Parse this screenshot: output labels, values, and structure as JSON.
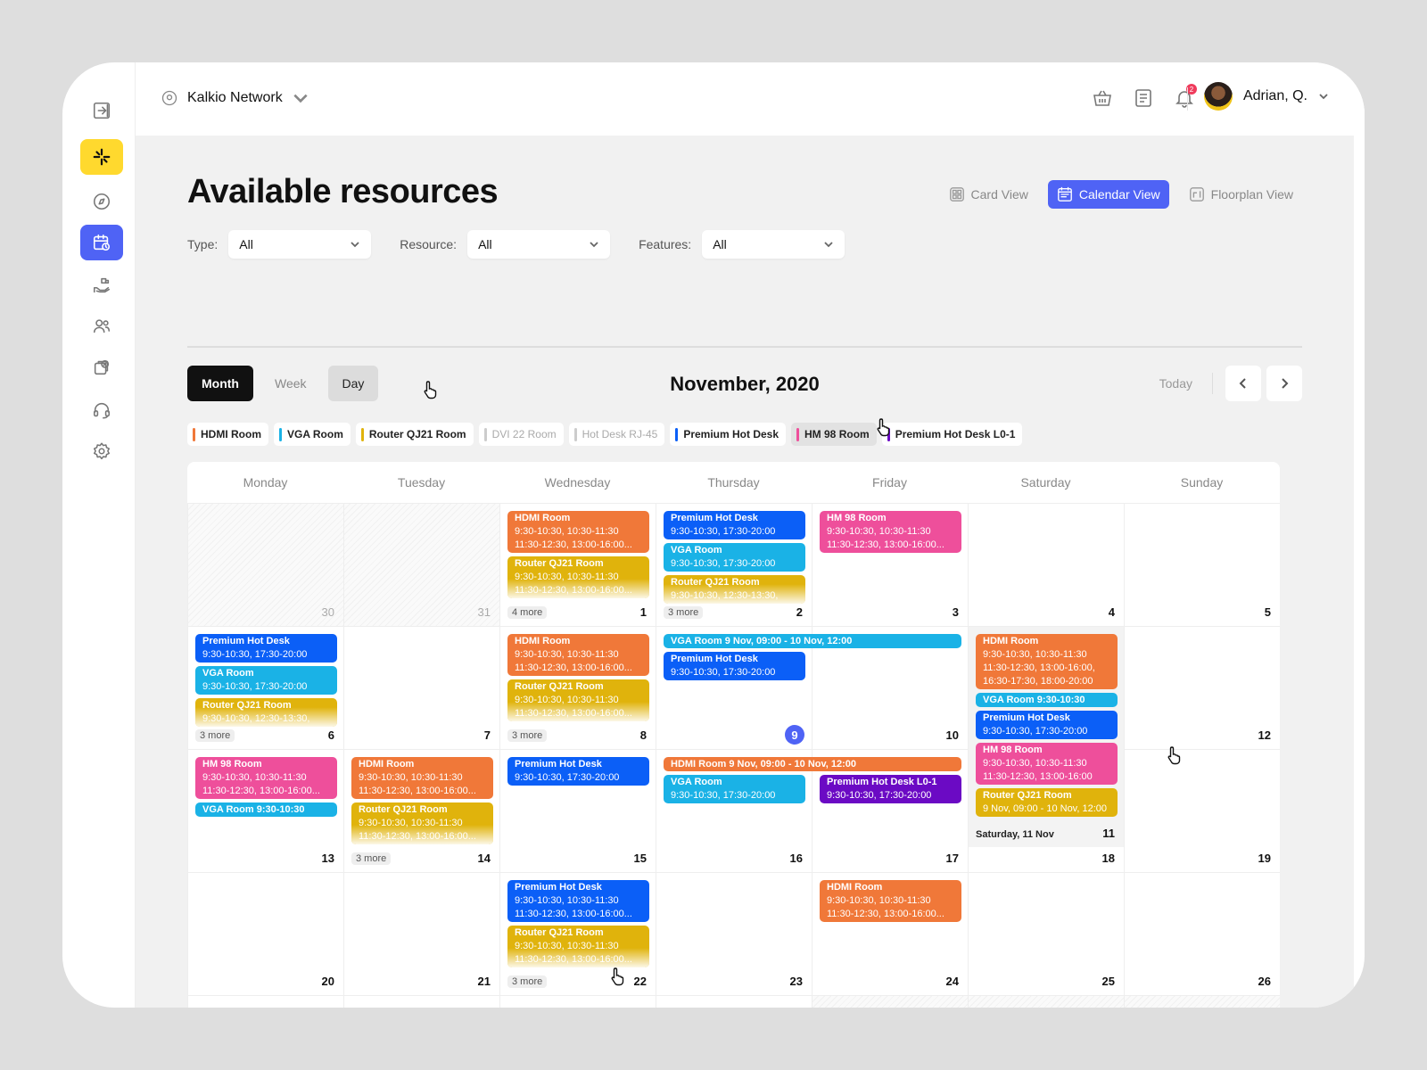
{
  "colors": {
    "accent": "#4f63f5",
    "hdmi": "#f07839",
    "vga": "#1ab2e6",
    "router": "#e0b30c",
    "premium": "#0b5ff7",
    "hm98": "#ee4f9b",
    "premiumL0": "#6b0ac4",
    "dvi": "#cccccc",
    "hotdesk": "#cccccc"
  },
  "network": {
    "name": "Kalkio Network"
  },
  "user": {
    "name": "Adrian, Q.",
    "notifications": "2"
  },
  "page": {
    "title": "Available resources"
  },
  "views": [
    {
      "label": "Card View",
      "icon": "grid-icon"
    },
    {
      "label": "Calendar View",
      "icon": "calendar-icon"
    },
    {
      "label": "Floorplan View",
      "icon": "floorplan-icon"
    }
  ],
  "filters": [
    {
      "label": "Type:",
      "value": "All"
    },
    {
      "label": "Resource:",
      "value": "All"
    },
    {
      "label": "Features:",
      "value": "All"
    }
  ],
  "modes": [
    "Month",
    "Week",
    "Day"
  ],
  "calendar": {
    "month_title": "November, 2020",
    "today_label": "Today"
  },
  "legend": [
    {
      "label": "HDMI Room",
      "color": "hdmi"
    },
    {
      "label": "VGA Room",
      "color": "vga"
    },
    {
      "label": "Router QJ21 Room",
      "color": "router"
    },
    {
      "label": "DVI 22 Room",
      "color": "dvi",
      "dim": true
    },
    {
      "label": "Hot Desk RJ-45",
      "color": "hotdesk",
      "dim": true
    },
    {
      "label": "Premium Hot Desk",
      "color": "premium"
    },
    {
      "label": "HM 98 Room",
      "color": "hm98",
      "hover": true
    },
    {
      "label": "Premium Hot Desk L0-1",
      "color": "premiumL0"
    }
  ],
  "weekdays": [
    "Monday",
    "Tuesday",
    "Wednesday",
    "Thursday",
    "Friday",
    "Saturday",
    "Sunday"
  ],
  "weeks": [
    [
      {
        "day": "30",
        "muted": true,
        "hatch": true
      },
      {
        "day": "31",
        "muted": true,
        "hatch": true
      },
      {
        "day": "1",
        "more": "4 more",
        "events": [
          {
            "title": "HDMI Room",
            "lines": [
              "9:30-10:30, 10:30-11:30",
              "11:30-12:30, 13:00-16:00..."
            ],
            "color": "hdmi"
          },
          {
            "title": "Router QJ21 Room",
            "lines": [
              "9:30-10:30, 10:30-11:30",
              "11:30-12:30, 13:00-16:00..."
            ],
            "color": "router",
            "fade": true
          }
        ]
      },
      {
        "day": "2",
        "more": "3 more",
        "events": [
          {
            "title": "Premium Hot Desk",
            "lines": [
              "9:30-10:30, 17:30-20:00"
            ],
            "color": "premium"
          },
          {
            "title": "VGA Room",
            "lines": [
              "9:30-10:30, 17:30-20:00"
            ],
            "color": "vga"
          },
          {
            "title": "Router QJ21 Room",
            "lines": [
              "9:30-10:30, 12:30-13:30,"
            ],
            "color": "router",
            "fade": true
          }
        ]
      },
      {
        "day": "3",
        "events": [
          {
            "title": "HM 98 Room",
            "lines": [
              "9:30-10:30, 10:30-11:30",
              "11:30-12:30, 13:00-16:00..."
            ],
            "color": "hm98"
          }
        ]
      },
      {
        "day": "4"
      },
      {
        "day": "5"
      }
    ],
    [
      {
        "day": "6",
        "more": "3 more",
        "events": [
          {
            "title": "Premium Hot Desk",
            "lines": [
              "9:30-10:30, 17:30-20:00"
            ],
            "color": "premium"
          },
          {
            "title": "VGA Room",
            "lines": [
              "9:30-10:30, 17:30-20:00"
            ],
            "color": "vga"
          },
          {
            "title": "Router QJ21 Room",
            "lines": [
              "9:30-10:30, 12:30-13:30,"
            ],
            "color": "router",
            "fade": true
          }
        ]
      },
      {
        "day": "7"
      },
      {
        "day": "8",
        "more": "3 more",
        "events": [
          {
            "title": "HDMI Room",
            "lines": [
              "9:30-10:30, 10:30-11:30",
              "11:30-12:30, 13:00-16:00..."
            ],
            "color": "hdmi"
          },
          {
            "title": "Router QJ21 Room",
            "lines": [
              "9:30-10:30, 10:30-11:30",
              "11:30-12:30, 13:00-16:00..."
            ],
            "color": "router",
            "fade": true
          }
        ]
      },
      {
        "day": "9",
        "today": true,
        "events": [
          {
            "single": "VGA Room 9 Nov, 09:00 - 10 Nov, 12:00",
            "color": "vga",
            "span": 2
          },
          {
            "title": "Premium Hot Desk",
            "lines": [
              "9:30-10:30, 17:30-20:00"
            ],
            "color": "premium"
          }
        ]
      },
      {
        "day": "10"
      },
      {
        "day": "11",
        "expanded": true,
        "label": "Saturday, 11 Nov",
        "events": [
          {
            "title": "HDMI Room",
            "lines": [
              "9:30-10:30, 10:30-11:30",
              "11:30-12:30, 13:00-16:00,",
              "16:30-17:30, 18:00-20:00"
            ],
            "color": "hdmi"
          },
          {
            "single": "VGA Room 9:30-10:30",
            "color": "vga"
          },
          {
            "title": "Premium Hot Desk",
            "lines": [
              "9:30-10:30, 17:30-20:00"
            ],
            "color": "premium"
          },
          {
            "title": "HM 98 Room",
            "lines": [
              "9:30-10:30, 10:30-11:30",
              "11:30-12:30, 13:00-16:00"
            ],
            "color": "hm98"
          },
          {
            "title": "Router QJ21 Room",
            "lines": [
              "9 Nov, 09:00 - 10 Nov, 12:00"
            ],
            "color": "router"
          }
        ]
      },
      {
        "day": "12"
      }
    ],
    [
      {
        "day": "13",
        "events": [
          {
            "title": "HM 98 Room",
            "lines": [
              "9:30-10:30, 10:30-11:30",
              "11:30-12:30, 13:00-16:00..."
            ],
            "color": "hm98"
          },
          {
            "single": "VGA Room 9:30-10:30",
            "color": "vga"
          }
        ]
      },
      {
        "day": "14",
        "more": "3 more",
        "events": [
          {
            "title": "HDMI Room",
            "lines": [
              "9:30-10:30, 10:30-11:30",
              "11:30-12:30, 13:00-16:00..."
            ],
            "color": "hdmi"
          },
          {
            "title": "Router QJ21 Room",
            "lines": [
              "9:30-10:30, 10:30-11:30",
              "11:30-12:30, 13:00-16:00..."
            ],
            "color": "router",
            "fade": true
          }
        ]
      },
      {
        "day": "15",
        "events": [
          {
            "title": "Premium Hot Desk",
            "lines": [
              "9:30-10:30, 17:30-20:00"
            ],
            "color": "premium"
          }
        ]
      },
      {
        "day": "16",
        "events": [
          {
            "single": "HDMI Room 9 Nov, 09:00 - 10 Nov, 12:00",
            "color": "hdmi",
            "span": 2
          },
          {
            "title": "VGA Room",
            "lines": [
              "9:30-10:30, 17:30-20:00"
            ],
            "color": "vga"
          }
        ]
      },
      {
        "day": "17",
        "events": [
          {
            "title": "Premium Hot Desk L0-1",
            "lines": [
              "9:30-10:30, 17:30-20:00"
            ],
            "color": "premiumL0",
            "offset": 20
          }
        ]
      },
      {
        "day": "18"
      },
      {
        "day": "19"
      }
    ],
    [
      {
        "day": "20"
      },
      {
        "day": "21"
      },
      {
        "day": "22",
        "more": "3 more",
        "events": [
          {
            "title": "Premium Hot Desk",
            "lines": [
              "9:30-10:30, 10:30-11:30",
              "11:30-12:30, 13:00-16:00..."
            ],
            "color": "premium"
          },
          {
            "title": "Router QJ21 Room",
            "lines": [
              "9:30-10:30, 10:30-11:30",
              "11:30-12:30, 13:00-16:00..."
            ],
            "color": "router",
            "fade": true
          }
        ]
      },
      {
        "day": "23"
      },
      {
        "day": "24",
        "events": [
          {
            "title": "HDMI Room",
            "lines": [
              "9:30-10:30, 10:30-11:30",
              "11:30-12:30, 13:00-16:00..."
            ],
            "color": "hdmi"
          }
        ]
      },
      {
        "day": "25"
      },
      {
        "day": "26"
      }
    ],
    [
      {
        "day": ""
      },
      {
        "day": ""
      },
      {
        "day": ""
      },
      {
        "day": ""
      },
      {
        "day": "",
        "hatch": true
      },
      {
        "day": "",
        "hatch": true
      },
      {
        "day": "",
        "hatch": true
      }
    ]
  ]
}
